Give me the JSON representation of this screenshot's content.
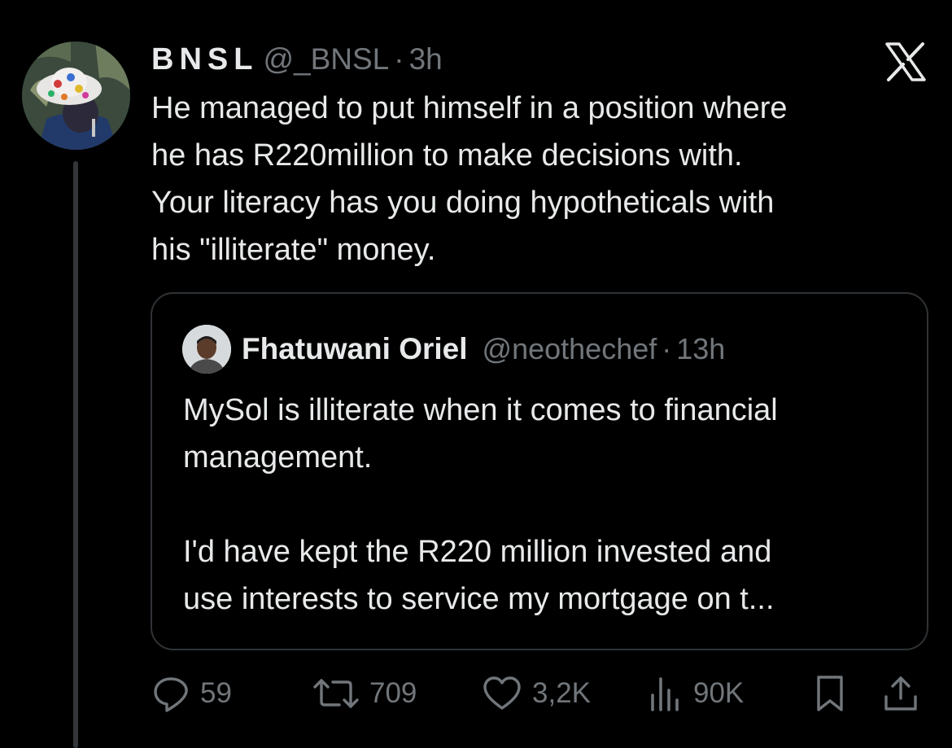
{
  "tweet": {
    "display_name": "BNSL",
    "handle": "@_BNSL",
    "separator": "·",
    "time": "3h",
    "text_lines": [
      "He managed to put himself in a position where",
      "he has R220million to make decisions with.",
      "Your literacy has you doing hypotheticals with",
      "his \"illiterate\" money."
    ]
  },
  "quote": {
    "display_name": "Fhatuwani Oriel",
    "handle": "@neothechef",
    "separator": "·",
    "time": "13h",
    "text_lines": [
      "MySol is illiterate when it comes to financial",
      "management.",
      "",
      "I'd have kept the R220 million invested and",
      "use interests to service my mortgage on t..."
    ]
  },
  "actions": {
    "replies": "59",
    "reposts": "709",
    "likes": "3,2K",
    "views": "90K"
  },
  "icons": {
    "brand": "x-logo-icon",
    "reply": "reply-icon",
    "repost": "repost-icon",
    "like": "heart-icon",
    "views": "views-icon",
    "bookmark": "bookmark-icon",
    "share": "share-icon"
  },
  "colors": {
    "background": "#000000",
    "text_primary": "#e7e9ea",
    "text_secondary": "#71767b",
    "border": "#2f3336"
  }
}
